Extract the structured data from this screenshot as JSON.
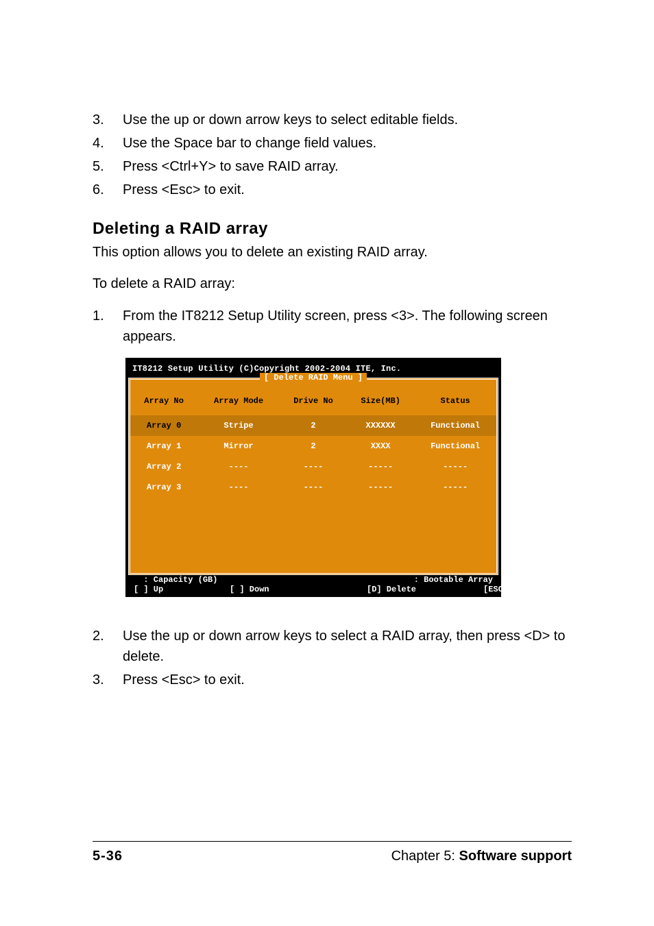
{
  "steps_top": [
    {
      "n": "3.",
      "t": "Use the up or down arrow keys to select editable fields."
    },
    {
      "n": "4.",
      "t": "Use the Space bar to change field values."
    },
    {
      "n": "5.",
      "t": "Press <Ctrl+Y> to save RAID array."
    },
    {
      "n": "6.",
      "t": "Press <Esc> to exit."
    }
  ],
  "section_title": "Deleting a RAID array",
  "intro1": "This option allows you to delete an existing RAID array.",
  "intro2": "To delete a RAID array:",
  "step1": {
    "n": "1.",
    "t": "From the IT8212 Setup Utility screen, press <3>. The following screen appears."
  },
  "raid": {
    "utility_line": "IT8212 Setup Utility (C)Copyright 2002-2004 ITE, Inc.",
    "panel_title": "[ Delete RAID Menu ]",
    "headers": [
      "Array No",
      "Array Mode",
      "Drive No",
      "Size(MB)",
      "Status"
    ],
    "rows": [
      {
        "selected": true,
        "cells": [
          "Array 0",
          "Stripe",
          "2",
          "XXXXXX",
          "Functional"
        ]
      },
      {
        "selected": false,
        "cells": [
          "Array 1",
          "Mirror",
          "2",
          "XXXX",
          "Functional"
        ]
      },
      {
        "selected": false,
        "cells": [
          "Array 2",
          "----",
          "----",
          "-----",
          "-----"
        ]
      },
      {
        "selected": false,
        "cells": [
          "Array 3",
          "----",
          "----",
          "-----",
          "-----"
        ]
      }
    ],
    "footer": {
      "capacity": "  : Capacity (GB)",
      "bootable": "  : Bootable Array",
      "up": "[ ] Up",
      "down": "[ ] Down",
      "delete": "[D] Delete",
      "exit": "[ESC] Exit"
    }
  },
  "steps_bottom": [
    {
      "n": "2.",
      "t": "Use the up or down arrow keys to select a RAID array, then press <D> to delete."
    },
    {
      "n": "3.",
      "t": "Press <Esc> to exit."
    }
  ],
  "footer": {
    "page": "5-36",
    "chapter_prefix": "Chapter 5: ",
    "chapter_bold": "Software support"
  }
}
